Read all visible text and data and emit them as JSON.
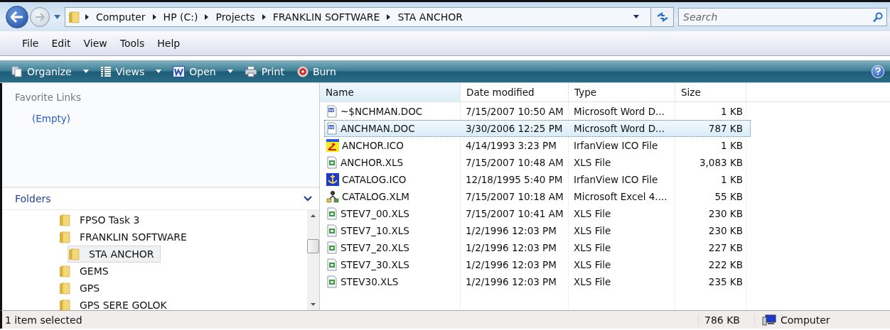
{
  "address_bar": {
    "crumbs": [
      "Computer",
      "HP (C:)",
      "Projects",
      "FRANKLIN SOFTWARE",
      "STA ANCHOR"
    ]
  },
  "search": {
    "placeholder": "Search"
  },
  "menu": [
    "File",
    "Edit",
    "View",
    "Tools",
    "Help"
  ],
  "toolbar": [
    {
      "label": "Organize",
      "kind": "organize",
      "dropdown": true
    },
    {
      "label": "Views",
      "kind": "views",
      "dropdown": true
    },
    {
      "label": "Open",
      "kind": "word",
      "dropdown": true
    },
    {
      "label": "Print",
      "kind": "print",
      "dropdown": false
    },
    {
      "label": "Burn",
      "kind": "burn",
      "dropdown": false
    }
  ],
  "favorite_links": {
    "title": "Favorite Links",
    "items": [
      "(Empty)"
    ]
  },
  "folders": {
    "title": "Folders",
    "tree": [
      {
        "label": "FPSO Task 3",
        "selected": false
      },
      {
        "label": "FRANKLIN SOFTWARE",
        "selected": false,
        "children": [
          {
            "label": "STA ANCHOR",
            "selected": true
          }
        ]
      },
      {
        "label": "GEMS",
        "selected": false
      },
      {
        "label": "GPS",
        "selected": false
      },
      {
        "label": "GPS SERE GOLOK",
        "selected": false
      }
    ]
  },
  "table": {
    "columns": [
      "Name",
      "Date modified",
      "Type",
      "Size"
    ],
    "rows": [
      {
        "kind": "doc",
        "name": "~$NCHMAN.DOC",
        "date": "7/15/2007 10:50 AM",
        "type": "Microsoft Word D...",
        "size": "1 KB",
        "selected": false
      },
      {
        "kind": "doc",
        "name": "ANCHMAN.DOC",
        "date": "3/30/2006 12:25 PM",
        "type": "Microsoft Word D...",
        "size": "787 KB",
        "selected": true
      },
      {
        "kind": "arrow-ico",
        "name": "ANCHOR.ICO",
        "date": "4/14/1993 3:23 PM",
        "type": "IrfanView ICO File",
        "size": "1 KB",
        "selected": false
      },
      {
        "kind": "xls",
        "name": "ANCHOR.XLS",
        "date": "7/15/2007 10:48 AM",
        "type": "XLS File",
        "size": "3,083 KB",
        "selected": false
      },
      {
        "kind": "anchor-ico",
        "name": "CATALOG.ICO",
        "date": "12/18/1995 5:40 PM",
        "type": "IrfanView ICO File",
        "size": "1 KB",
        "selected": false
      },
      {
        "kind": "xlm",
        "name": "CATALOG.XLM",
        "date": "7/15/2007 10:18 AM",
        "type": "Microsoft Excel 4....",
        "size": "55 KB",
        "selected": false
      },
      {
        "kind": "xls",
        "name": "STEV7_00.XLS",
        "date": "7/15/2007 10:41 AM",
        "type": "XLS File",
        "size": "230 KB",
        "selected": false
      },
      {
        "kind": "xls",
        "name": "STEV7_10.XLS",
        "date": "1/2/1996 12:03 PM",
        "type": "XLS File",
        "size": "230 KB",
        "selected": false
      },
      {
        "kind": "xls",
        "name": "STEV7_20.XLS",
        "date": "1/2/1996 12:03 PM",
        "type": "XLS File",
        "size": "227 KB",
        "selected": false
      },
      {
        "kind": "xls",
        "name": "STEV7_30.XLS",
        "date": "1/2/1996 12:03 PM",
        "type": "XLS File",
        "size": "222 KB",
        "selected": false
      },
      {
        "kind": "xls",
        "name": "STEV30.XLS",
        "date": "1/2/1996 12:03 PM",
        "type": "XLS File",
        "size": "235 KB",
        "selected": false
      }
    ]
  },
  "status_bar": {
    "selection": "1 item selected",
    "size": "786 KB",
    "location": "Computer"
  }
}
